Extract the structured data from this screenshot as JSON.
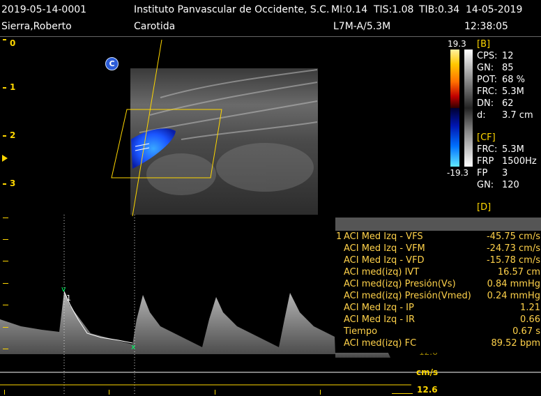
{
  "header": {
    "patient_id": "2019-05-14-0001",
    "institution": "Instituto Panvascular de Occidente, S.C.",
    "mi": "MI:0.14",
    "tis": "TIS:1.08",
    "tib": "TIB:0.34",
    "date": "14-05-2019",
    "patient_name": "Sierra,Roberto",
    "exam": "Carotida",
    "probe": "L7M-A/5.3M",
    "time": "12:38:05"
  },
  "depth_scale": [
    "0",
    "1",
    "2",
    "3"
  ],
  "color_scale": {
    "max": "19.3",
    "min": "-19.3"
  },
  "color_mode_badge": "C",
  "params_b": {
    "title": "[B]",
    "items": [
      {
        "k": "CPS:",
        "v": "12"
      },
      {
        "k": "GN:",
        "v": "85"
      },
      {
        "k": "POT:",
        "v": "68 %"
      },
      {
        "k": "FRC:",
        "v": "5.3M"
      },
      {
        "k": "DN:",
        "v": "62"
      },
      {
        "k": "d:",
        "v": "3.7 cm"
      }
    ]
  },
  "params_cf": {
    "title": "[CF]",
    "items": [
      {
        "k": "FRC:",
        "v": "5.3M"
      },
      {
        "k": "FRP",
        "v": "1500Hz"
      },
      {
        "k": "FP",
        "v": "3"
      },
      {
        "k": "GN:",
        "v": "120"
      }
    ]
  },
  "params_d": {
    "title": "[D]"
  },
  "measurements": [
    {
      "idx": "1",
      "label": "ACI Med Izq - VFS",
      "value": "-45.75 cm/s"
    },
    {
      "idx": "",
      "label": "ACI Med Izq - VFM",
      "value": "-24.73 cm/s"
    },
    {
      "idx": "",
      "label": "ACI Med Izq - VFD",
      "value": "-15.78 cm/s"
    },
    {
      "idx": "",
      "label": "ACI med(izq) IVT",
      "value": "16.57 cm"
    },
    {
      "idx": "",
      "label": "ACI med(izq) Presión(Vs)",
      "value": "0.84 mmHg"
    },
    {
      "idx": "",
      "label": "ACI med(izq) Presión(Vmed)",
      "value": "0.24 mmHg"
    },
    {
      "idx": "",
      "label": "ACI Med Izq - IP",
      "value": "1.21"
    },
    {
      "idx": "",
      "label": "ACI Med Izq - IR",
      "value": "0.66"
    },
    {
      "idx": "",
      "label": "Tiempo",
      "value": "0.67 s"
    },
    {
      "idx": "",
      "label": "ACI med(izq) FC",
      "value": "89.52 bpm"
    }
  ],
  "spectral": {
    "unit": "cm/s",
    "scale_value": "12.6",
    "cursor_label": "1",
    "baseline_partial": "12.6"
  },
  "colors": {
    "accent_yellow": "#ffd700",
    "measure_text": "#ffd24a",
    "doppler_blue": "#1a55ff"
  }
}
